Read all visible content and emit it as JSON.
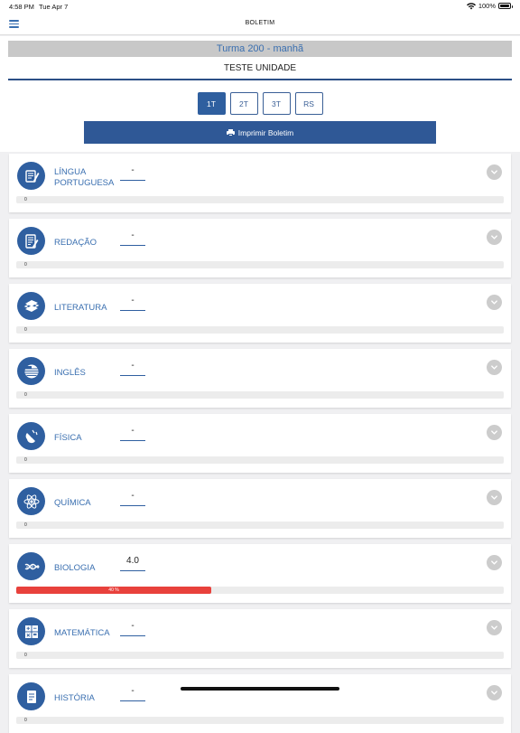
{
  "status_bar": {
    "time": "4:58 PM",
    "date": "Tue Apr 7",
    "battery": "100%"
  },
  "nav": {
    "title": "BOLETIM"
  },
  "header": {
    "class_label": "Turma 200 - manhã",
    "unit_label": "TESTE UNIDADE"
  },
  "terms": [
    {
      "label": "1T",
      "active": true
    },
    {
      "label": "2T",
      "active": false
    },
    {
      "label": "3T",
      "active": false
    },
    {
      "label": "RS",
      "active": false
    }
  ],
  "print_button": {
    "label": "Imprimir Boletim"
  },
  "subjects": [
    {
      "name": "LÍNGUA PORTUGUESA",
      "grade": "-",
      "progress_label": "0",
      "progress": 0,
      "icon": "book-writing-icon"
    },
    {
      "name": "REDAÇÃO",
      "grade": "-",
      "progress_label": "0",
      "progress": 0,
      "icon": "document-pen-icon"
    },
    {
      "name": "LITERATURA",
      "grade": "-",
      "progress_label": "0",
      "progress": 0,
      "icon": "books-stack-icon"
    },
    {
      "name": "INGLÊS",
      "grade": "-",
      "progress_label": "0",
      "progress": 0,
      "icon": "flag-stripes-icon"
    },
    {
      "name": "FÍSICA",
      "grade": "-",
      "progress_label": "0",
      "progress": 0,
      "icon": "magnet-icon"
    },
    {
      "name": "QUÍMICA",
      "grade": "-",
      "progress_label": "0",
      "progress": 0,
      "icon": "atom-icon"
    },
    {
      "name": "BIOLOGIA",
      "grade": "4.0",
      "progress_label": "40 %",
      "progress": 0.4,
      "icon": "dna-icon"
    },
    {
      "name": "MATEMÁTICA",
      "grade": "-",
      "progress_label": "0",
      "progress": 0,
      "icon": "calculator-icon"
    },
    {
      "name": "HISTÓRIA",
      "grade": "-",
      "progress_label": "0",
      "progress": 0,
      "icon": "scroll-icon"
    }
  ],
  "colors": {
    "accent": "#2f5896",
    "progress_bad": "#e8413c",
    "text_blue": "#3a6fb0"
  }
}
